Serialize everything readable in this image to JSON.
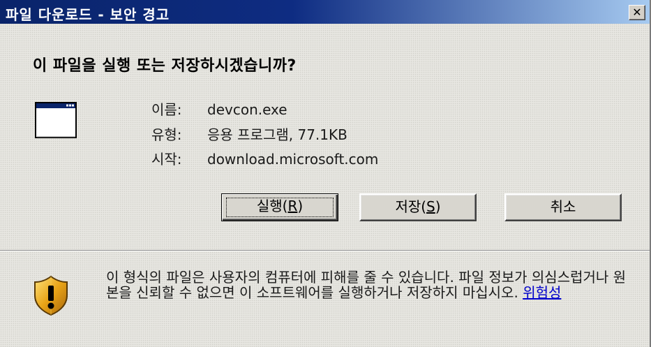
{
  "window": {
    "title": "파일 다운로드 - 보안 경고",
    "close_glyph": "✕"
  },
  "prompt": {
    "question": "이 파일을 실행 또는 저장하시겠습니까?"
  },
  "file": {
    "icon": "application-window-icon",
    "name_label": "이름:",
    "name_value": "devcon.exe",
    "type_label": "유형:",
    "type_value": "응용 프로그램, 77.1KB",
    "from_label": "시작:",
    "from_value": "download.microsoft.com"
  },
  "buttons": {
    "run_text": "실행(",
    "run_key": "R",
    "run_close": ")",
    "save_text": "저장(",
    "save_key": "S",
    "save_close": ")",
    "cancel": "취소"
  },
  "warning": {
    "icon": "security-shield-icon",
    "text": "이 형식의 파일은 사용자의 컴퓨터에 피해를 줄 수 있습니다. 파일 정보가 의심스럽거나 원본을 신뢰할 수 없으면 이 소프트웨어를 실행하거나 저장하지 마십시오. ",
    "link": "위험성"
  },
  "colors": {
    "titlebar_start": "#0a246a",
    "titlebar_end": "#a6caf0",
    "link": "#0000cc",
    "shield_gold": "#e8a317"
  }
}
